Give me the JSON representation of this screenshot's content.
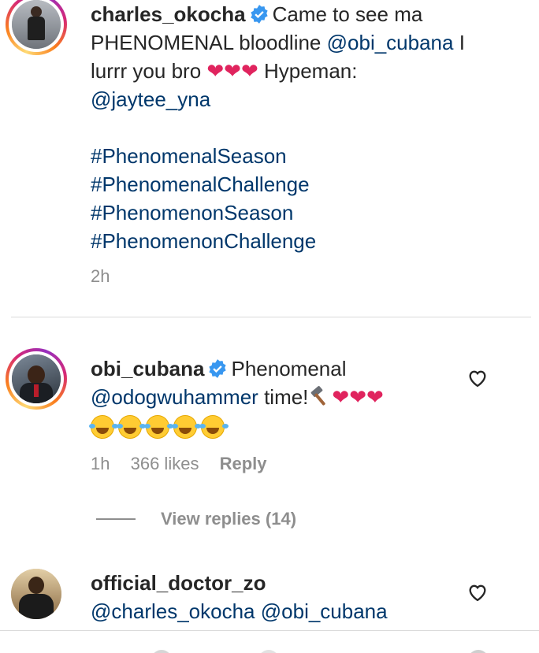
{
  "comments": [
    {
      "username": "charles_okocha",
      "verified": true,
      "text_1": "Came to see ma",
      "text_2": "PHENOMENAL bloodline",
      "mention_1": "@obi_cubana",
      "text_3": "I",
      "text_4": "lurrr you bro",
      "text_5": "Hypeman:",
      "mention_2": "@jaytee_yna",
      "hashtags": [
        "#PhenomenalSeason",
        "#PhenomenalChallenge",
        "#PhenomenonSeason",
        "#PhenomenonChallenge"
      ],
      "time": "2h"
    },
    {
      "username": "obi_cubana",
      "verified": true,
      "text_1": "Phenomenal",
      "mention_1": "@odogwuhammer",
      "text_2": "time!",
      "time": "1h",
      "likes": "366 likes",
      "reply_label": "Reply",
      "view_replies": "View replies (14)"
    },
    {
      "username": "official_doctor_zo",
      "mention_1": "@charles_okocha",
      "mention_2": "@obi_cubana"
    }
  ],
  "icons": {
    "verified": "verified-badge-icon",
    "like": "heart-outline-icon",
    "hammer": "hammer-emoji",
    "heart": "red-heart-emoji",
    "laugh": "rolling-laughing-emoji"
  },
  "colors": {
    "mention": "#00376b",
    "verified": "#3897f0",
    "meta": "#8e8e8e",
    "heart": "#e0245e"
  }
}
